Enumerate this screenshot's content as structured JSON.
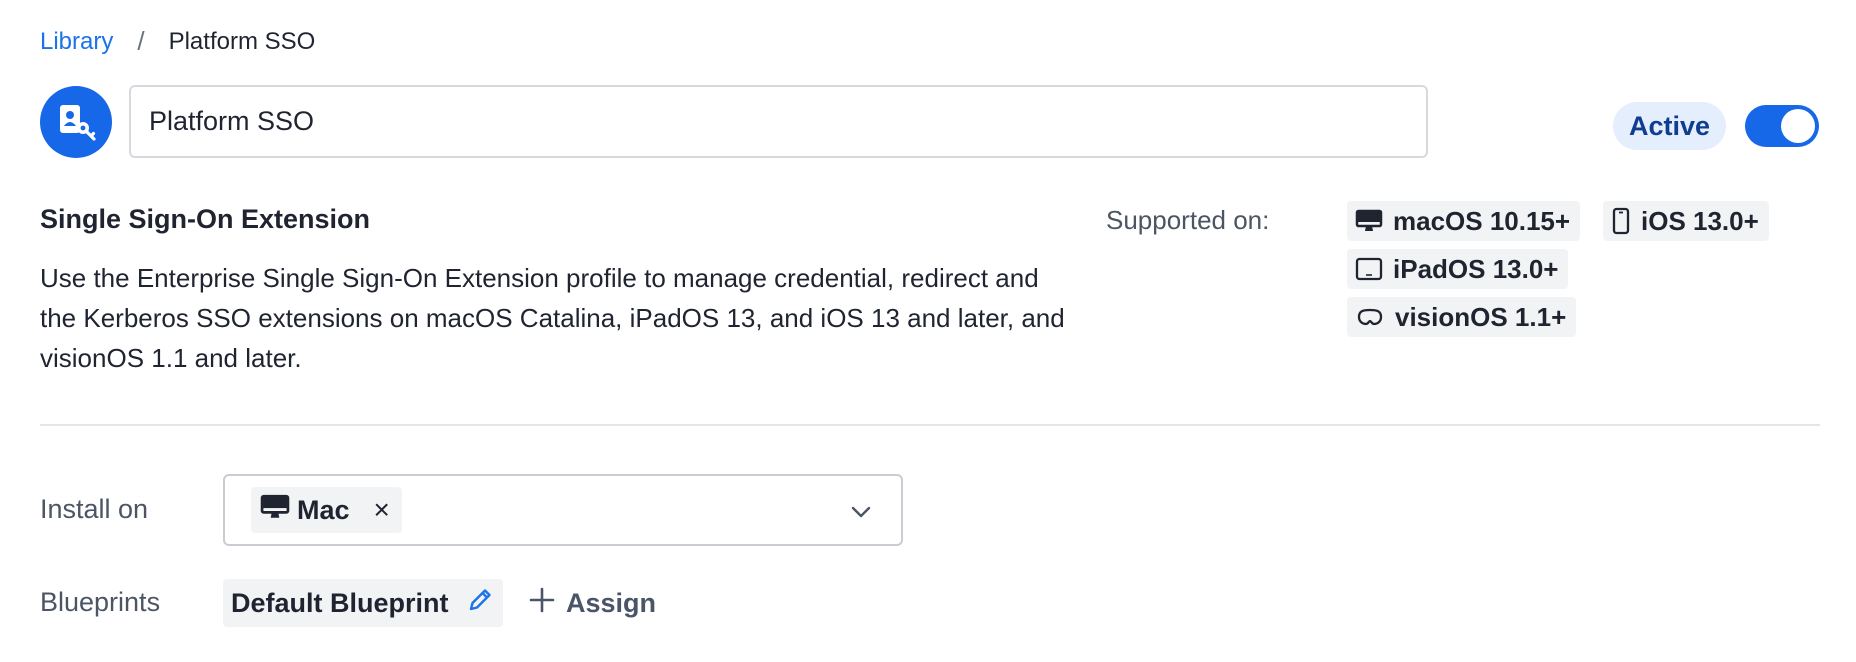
{
  "breadcrumb": {
    "root": "Library",
    "separator": "/",
    "current": "Platform SSO"
  },
  "header": {
    "icon": "sso-extension-icon",
    "name_value": "Platform SSO",
    "status": "Active",
    "toggle_on": true
  },
  "extension": {
    "title": "Single Sign-On Extension",
    "description": "Use the Enterprise Single Sign-On Extension profile to manage credential, redirect and the Kerberos SSO extensions on macOS Catalina, iPadOS 13, and iOS 13 and later, and visionOS 1.1 and later.",
    "supported_label": "Supported on:",
    "platforms": [
      {
        "icon": "desktop-icon",
        "label": "macOS 10.15+"
      },
      {
        "icon": "phone-icon",
        "label": "iOS 13.0+"
      },
      {
        "icon": "tablet-icon",
        "label": "iPadOS 13.0+"
      },
      {
        "icon": "vision-headset-icon",
        "label": "visionOS 1.1+"
      }
    ]
  },
  "install": {
    "label": "Install on",
    "selected": [
      {
        "icon": "desktop-icon",
        "label": "Mac"
      }
    ],
    "remove_glyph": "×"
  },
  "blueprints": {
    "label": "Blueprints",
    "items": [
      "Default Blueprint"
    ],
    "assign_label": "Assign"
  },
  "colors": {
    "accent": "#1668e8",
    "link": "#1a73e8",
    "active_pill_bg": "#e4eefc",
    "active_pill_text": "#0f3d8f",
    "chip_bg": "#f2f3f5"
  }
}
